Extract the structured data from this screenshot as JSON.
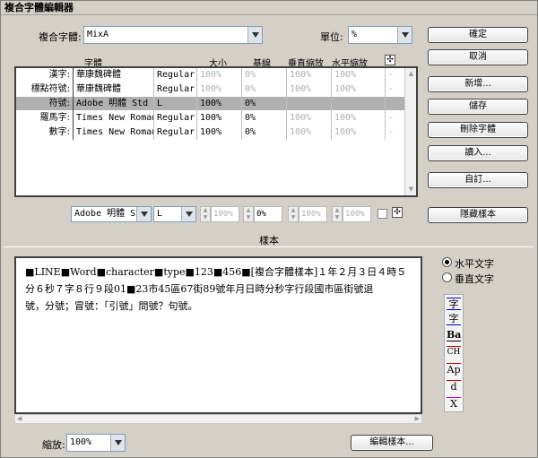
{
  "window": {
    "title": "複合字體編輯器"
  },
  "composite_font": {
    "label": "複合字體:",
    "value": "MixA"
  },
  "units": {
    "label": "單位:",
    "value": "%"
  },
  "buttons": {
    "ok": "確定",
    "cancel": "取消",
    "new": "新增...",
    "save": "儲存",
    "delete_font": "刪除字體",
    "import": "讀入...",
    "custom": "自訂...",
    "hide_sample": "隱藏樣本",
    "edit_sample": "編輯樣本..."
  },
  "table": {
    "headers": {
      "font": "字體",
      "size": "大小",
      "baseline": "基線",
      "vscale": "垂直縮放",
      "hscale": "水平縮放"
    },
    "rows": [
      {
        "category": "漢字:",
        "font": "華康魏碑體",
        "style": "Regular",
        "size": "100%",
        "baseline": "0%",
        "vscale": "100%",
        "hscale": "100%",
        "extra": "-"
      },
      {
        "category": "標點符號:",
        "font": "華康魏碑體",
        "style": "Regular",
        "size": "100%",
        "baseline": "0%",
        "vscale": "100%",
        "hscale": "100%",
        "extra": "-"
      },
      {
        "category": "符號:",
        "font": "Adobe 明體 Std",
        "style": "L",
        "size": "100%",
        "baseline": "0%",
        "vscale": "100%",
        "hscale": "100%",
        "extra": "-"
      },
      {
        "category": "羅馬字:",
        "font": "Times New Roman",
        "style": "Regular",
        "size": "100%",
        "baseline": "0%",
        "vscale": "100%",
        "hscale": "100%",
        "extra": "-"
      },
      {
        "category": "數字:",
        "font": "Times New Roman",
        "style": "Regular",
        "size": "100%",
        "baseline": "0%",
        "vscale": "100%",
        "hscale": "100%",
        "extra": "-"
      }
    ]
  },
  "edit_row": {
    "font": "Adobe 明體 Std",
    "style": "L",
    "size": "100%",
    "baseline": "0%",
    "vscale": "100%",
    "hscale": "100%"
  },
  "sample": {
    "label": "樣本",
    "line1": "■LINE■Word■character■type■123■456■[複合字體樣本]１年２月３日４時５",
    "line2": "分６秒７字８行９段01■23市45區67街89號年月日時分秒字行段國市區街號退",
    "line3": "號，分號；冒號：「引號」問號？句號。"
  },
  "orientation": {
    "horizontal": "水平文字",
    "vertical": "垂直文字",
    "selected": "horizontal"
  },
  "glyph_toolbar": [
    "字",
    "字",
    "Ba",
    "CH",
    "Ap",
    "d",
    "X"
  ],
  "zoom": {
    "label": "縮放:",
    "value": "100%"
  }
}
